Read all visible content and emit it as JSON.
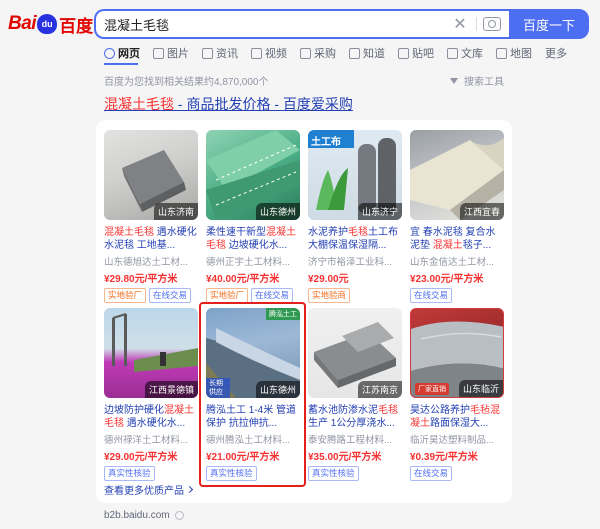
{
  "logo": {
    "bai": "Bai",
    "paw": "du",
    "du": "百度"
  },
  "search": {
    "query": "混凝土毛毯",
    "button_label": "百度一下"
  },
  "tabs": [
    {
      "label": "网页"
    },
    {
      "label": "图片"
    },
    {
      "label": "资讯"
    },
    {
      "label": "视频"
    },
    {
      "label": "采购"
    },
    {
      "label": "知道"
    },
    {
      "label": "贴吧"
    },
    {
      "label": "文库"
    },
    {
      "label": "地图"
    },
    {
      "label": "更多"
    }
  ],
  "result_count": "百度为您找到相关结果约4,870,000个",
  "tools_label": "搜索工具",
  "result": {
    "title_hl": "混凝土毛毯",
    "title_rest": " - 商品批发价格 - 百度爱采购"
  },
  "products": [
    {
      "location": "山东济南",
      "name_pre": "",
      "name_hl": "混凝土毛毯",
      "name_post": " 遇水硬化 水泥毯 工地基...",
      "shop": "山东德旭达土工材...",
      "price": "¥29.80元/平方米",
      "badges": [
        "实地验厂",
        "在线交易"
      ]
    },
    {
      "location": "山东德州",
      "name_pre": "柔性速干新型",
      "name_hl": "混凝土毛毯",
      "name_post": " 边坡硬化水...",
      "shop": "德州正宇土工材料...",
      "price": "¥40.00元/平方米",
      "badges": [
        "实地验厂",
        "在线交易"
      ]
    },
    {
      "location": "山东济宁",
      "img_label": "土工布",
      "name_pre": "水泥养护",
      "name_hl": "毛毯",
      "name_post": "土工布 大棚保温保湿隔...",
      "shop": "济宁市裕泽工业科...",
      "price": "¥29.00元",
      "badges": [
        "实地验商"
      ]
    },
    {
      "location": "江西宜春",
      "name_pre": "宜 春水泥毯 复合水泥垫 ",
      "name_hl": "混凝土",
      "name_post": "毯子...",
      "shop": "山东金信达土工材...",
      "price": "¥23.00元/平方米",
      "badges": [
        "在线交易"
      ]
    },
    {
      "location": "江西景德镇",
      "name_pre": "边坡防护硬化",
      "name_hl": "混凝土毛毯",
      "name_post": " 遇水硬化水...",
      "shop": "德州禄洋土工材料...",
      "price": "¥29.00元/平方米",
      "badges": [
        "真实性核验"
      ]
    },
    {
      "location": "山东德州",
      "tag_left": "长期供应",
      "tag_top": "腾泓土工",
      "name_pre": "腾泓土工 1-4米 管道保护 抗拉伸抗...",
      "name_hl": "",
      "name_post": "",
      "shop": "德州腾泓土工材料...",
      "price": "¥21.00元/平方米",
      "badges": [
        "真实性核验"
      ]
    },
    {
      "location": "江苏南京",
      "name_pre": "蓄水池防渗水泥",
      "name_hl": "毛毯",
      "name_post": "生产 1公分厚浇水...",
      "shop": "泰安腾路工程材料...",
      "price": "¥35.00元/平方米",
      "badges": [
        "真实性核验"
      ]
    },
    {
      "location": "山东临沂",
      "tag_fac": "厂家直销",
      "name_pre": "昊达公路养护",
      "name_hl": "毛毡混凝土",
      "name_post": "路面保湿大...",
      "shop": "临沂昊达塑料制品...",
      "price": "¥0.39元/平方米",
      "badges": [
        "在线交易"
      ]
    }
  ],
  "see_more": "查看更多优质产品",
  "source": "b2b.baidu.com",
  "colors": {
    "brand_blue": "#4e6ef2",
    "highlight_red": "#f73131",
    "link_blue": "#2440b3",
    "annotation_red": "#e4201b"
  }
}
